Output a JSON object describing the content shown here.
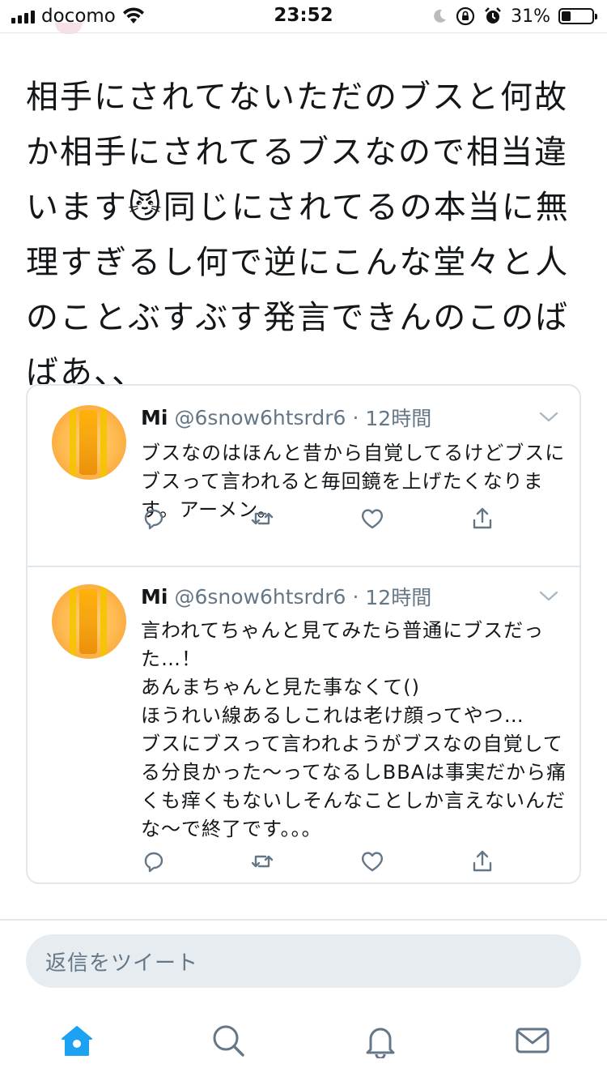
{
  "status_bar": {
    "carrier": "docomo",
    "time": "23:52",
    "battery_percent": "31%",
    "battery_level": 0.31
  },
  "main_tweet": {
    "text": "相手にされてないただのブスと何故か相手にされてるブスなので相当違います😼同じにされてるの本当に無理すぎるし何で逆にこんな堂々と人のことぶすぶす発言できんのこのばばあ、、"
  },
  "quoted_tweets": [
    {
      "name": "Mi",
      "handle": "@6snow6htsrdr6",
      "dot": "·",
      "time": "12時間",
      "text": "ブスなのはほんと昔から自覚してるけどブスにブスって言われると毎回鏡を上げたくなります。アーメン。"
    },
    {
      "name": "Mi",
      "handle": "@6snow6htsrdr6",
      "dot": "·",
      "time": "12時間",
      "text": "言われてちゃんと見てみたら普通にブスだった…！\nあんまちゃんと見た事なくて()\nほうれい線あるしこれは老け顔ってやつ…\nブスにブスって言われようがブスなの自覚してる分良かった〜ってなるしBBAは事実だから痛くも痒くもないしそんなことしか言えないんだな〜で終了です。。。"
    }
  ],
  "reply": {
    "placeholder": "返信をツイート"
  },
  "tabs": [
    {
      "icon": "home-icon",
      "active": true
    },
    {
      "icon": "search-icon",
      "active": false
    },
    {
      "icon": "bell-icon",
      "active": false
    },
    {
      "icon": "mail-icon",
      "active": false
    }
  ],
  "colors": {
    "accent": "#1da1f2",
    "text": "#14171a",
    "secondary": "#657786",
    "border": "#e1e8ed",
    "reply_bg": "#e6ecf0"
  }
}
